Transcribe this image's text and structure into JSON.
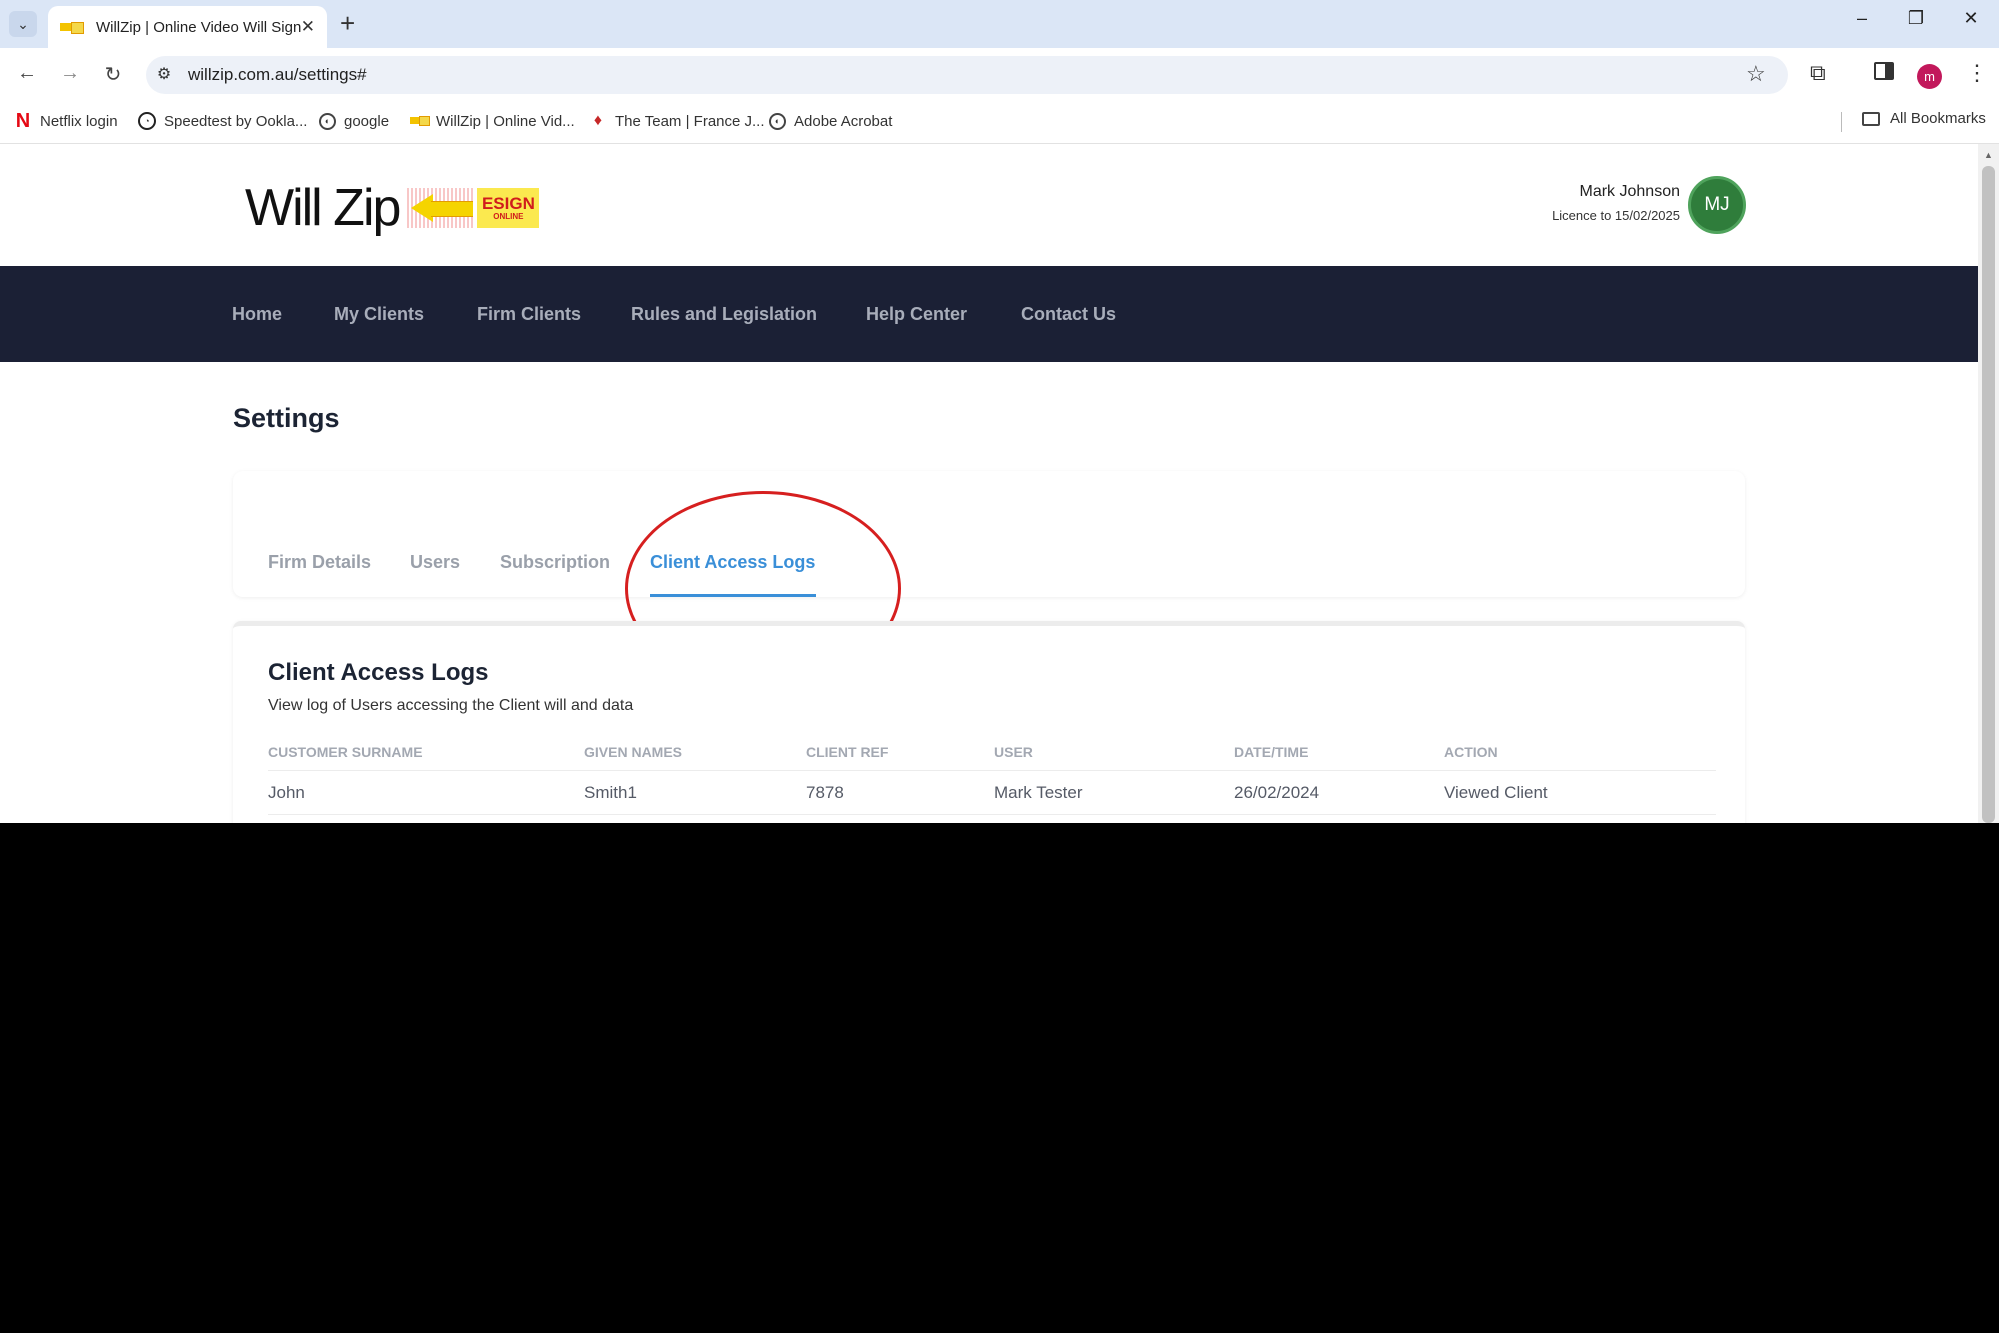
{
  "browser": {
    "tab_title": "WillZip | Online Video Will Signing",
    "new_tab_label": "+",
    "url": "willzip.com.au/settings#",
    "bookmarks": [
      {
        "label": "Netflix login",
        "icon": "netflix-icon"
      },
      {
        "label": "Speedtest by Ookla...",
        "icon": "speedtest-icon"
      },
      {
        "label": "google",
        "icon": "globe-icon"
      },
      {
        "label": "WillZip | Online Vid...",
        "icon": "willzip-icon"
      },
      {
        "label": "The Team | France J...",
        "icon": "team-icon"
      },
      {
        "label": "Adobe Acrobat",
        "icon": "globe-icon"
      }
    ],
    "all_bookmarks_label": "All Bookmarks",
    "profile_initial": "m"
  },
  "site": {
    "logo_text": "Will Zip",
    "logo_badge_main": "ESIGN",
    "logo_badge_sub": "ONLINE",
    "user": {
      "name": "Mark Johnson",
      "licence": "Licence to 15/02/2025",
      "initials": "MJ"
    },
    "nav": [
      "Home",
      "My Clients",
      "Firm Clients",
      "Rules and Legislation",
      "Help Center",
      "Contact Us"
    ]
  },
  "settings": {
    "title": "Settings",
    "tabs": [
      "Firm Details",
      "Users",
      "Subscription",
      "Client Access Logs"
    ],
    "active_tab": "Client Access Logs"
  },
  "logs": {
    "title": "Client Access Logs",
    "description": "View log of Users accessing the Client will and data",
    "columns": [
      "CUSTOMER SURNAME",
      "GIVEN NAMES",
      "CLIENT REF",
      "USER",
      "DATE/TIME",
      "ACTION"
    ],
    "rows": [
      [
        "John",
        "Smith1",
        "7878",
        "Mark Tester",
        "26/02/2024",
        "Viewed Client"
      ]
    ]
  },
  "colors": {
    "nav_background": "#1b2035",
    "active_tab": "#3a8fd8",
    "avatar": "#2f7d3b",
    "annotation": "#d61f1f"
  }
}
